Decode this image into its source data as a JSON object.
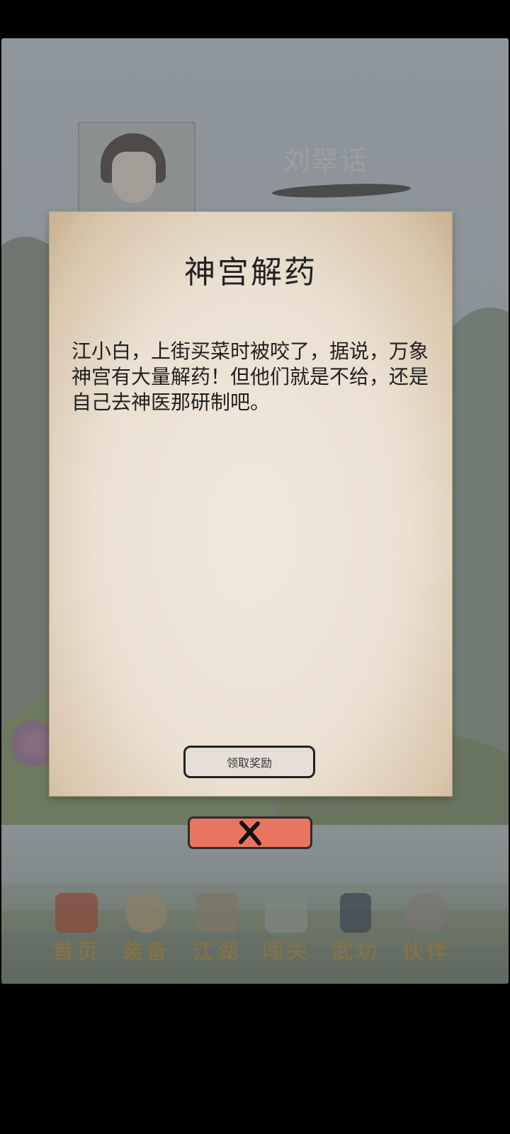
{
  "background": {
    "npc_name": "刘翠话"
  },
  "modal": {
    "title": "神宫解药",
    "body": "江小白，上街买菜时被咬了，据说，万象神宫有大量解药！但他们就是不给，还是自己去神医那研制吧。",
    "claim_label": "领取奖励"
  },
  "close_button": {
    "icon": "close-icon"
  },
  "nav": {
    "items": [
      {
        "label": "首页",
        "icon": "home-icon"
      },
      {
        "label": "装备",
        "icon": "equipment-icon"
      },
      {
        "label": "江湖",
        "icon": "jianghu-icon"
      },
      {
        "label": "闯关",
        "icon": "challenge-icon"
      },
      {
        "label": "武功",
        "icon": "martial-arts-icon"
      },
      {
        "label": "伙伴",
        "icon": "partners-icon"
      }
    ]
  },
  "colors": {
    "overlay": "#8f969c",
    "paper": "#ebe0d1",
    "close_button": "#e97561",
    "nav_label": "#8a7445"
  }
}
